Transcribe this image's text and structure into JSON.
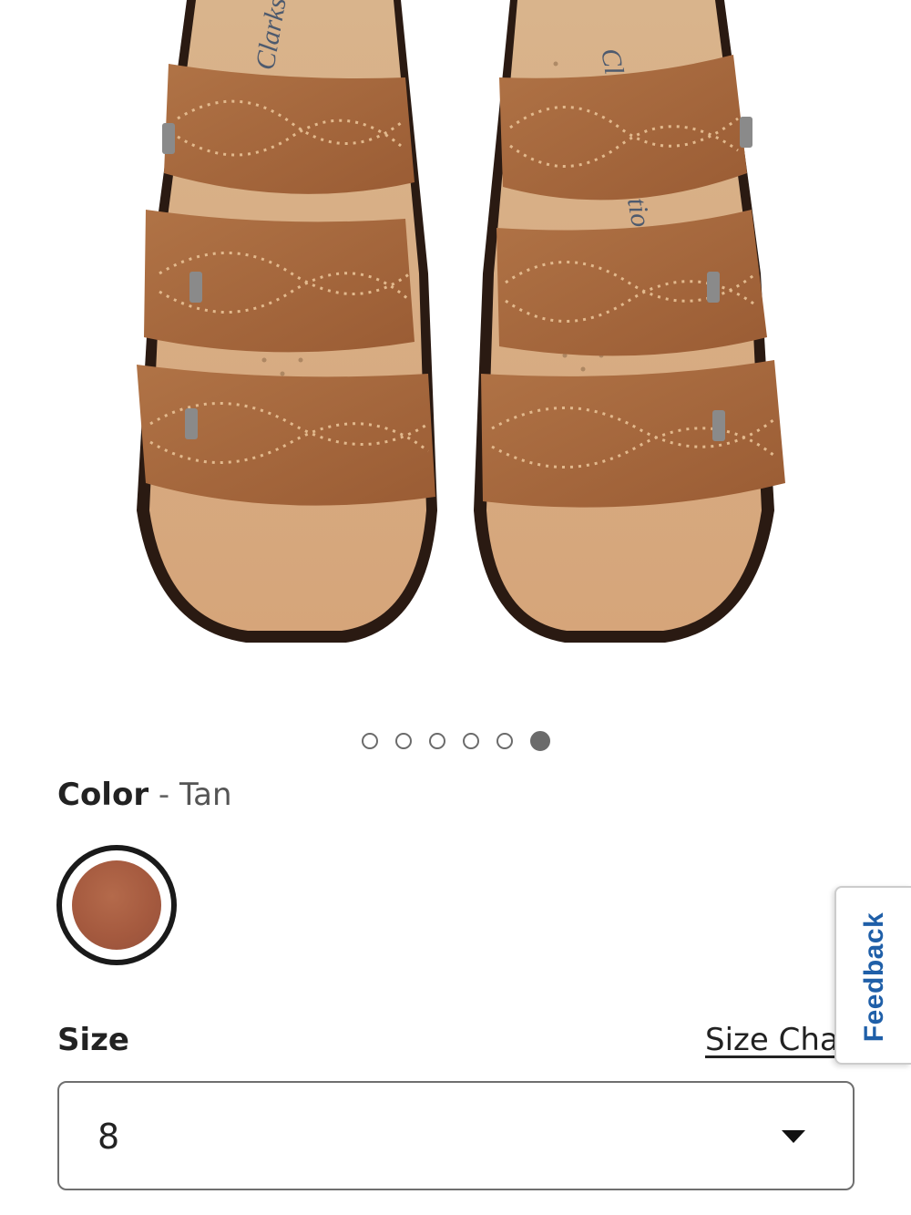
{
  "product_image": {
    "alt": "Clarks Collection sandals, top view",
    "insole_brand": "Clarks.",
    "insole_line": "collection"
  },
  "carousel": {
    "count": 6,
    "active_index": 5
  },
  "color": {
    "label": "Color",
    "separator": " - ",
    "value": "Tan",
    "swatch_color": "#a55a3f"
  },
  "size": {
    "label": "Size",
    "chart_link": "Size Chart",
    "selected": "8"
  },
  "feedback": {
    "label": "Feedback"
  },
  "colors": {
    "feedback_text": "#1f5fa8",
    "leather": "#a86a3e",
    "footbed": "#d7a676"
  }
}
